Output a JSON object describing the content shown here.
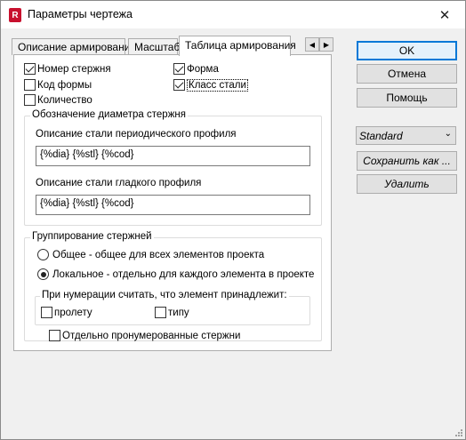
{
  "window": {
    "title": "Параметры чертежа",
    "app_icon_letter": "R",
    "close_label": "✕"
  },
  "tabs": [
    {
      "label": "Описание армирования"
    },
    {
      "label": "Масштаб"
    },
    {
      "label": "Таблица армирования"
    }
  ],
  "tab_scroll": {
    "left": "◀",
    "right": "▶"
  },
  "columns": {
    "bar_number": {
      "label": "Номер стержня",
      "checked": true
    },
    "shape_code": {
      "label": "Код формы",
      "checked": false
    },
    "quantity": {
      "label": "Количество",
      "checked": false
    },
    "shape": {
      "label": "Форма",
      "checked": true
    },
    "steel_class": {
      "label": "Класс стали",
      "checked": true
    }
  },
  "diameter_group": {
    "title": "Обозначение диаметра стержня",
    "periodic_label": "Описание стали периодического профиля",
    "periodic_value": "{%dia} {%stl} {%cod}",
    "smooth_label": "Описание стали гладкого профиля",
    "smooth_value": "{%dia} {%stl} {%cod}"
  },
  "grouping": {
    "title": "Группирование стержней",
    "general_label": "Общее - общее для всех элементов проекта",
    "local_label": "Локальное - отдельно для каждого элемента в проекте",
    "selected": "local",
    "numbering_title": "При нумерации считать, что элемент принадлежит:",
    "span_label": "пролету",
    "type_label": "типу",
    "separate_label": "Отдельно пронумерованные стержни"
  },
  "buttons": {
    "ok": "OK",
    "cancel": "Отмена",
    "help": "Помощь",
    "style_value": "Standard",
    "save_as": "Сохранить как ...",
    "delete": "Удалить"
  },
  "colors": {
    "accent": "#0078d7",
    "app_icon": "#c8102e"
  }
}
